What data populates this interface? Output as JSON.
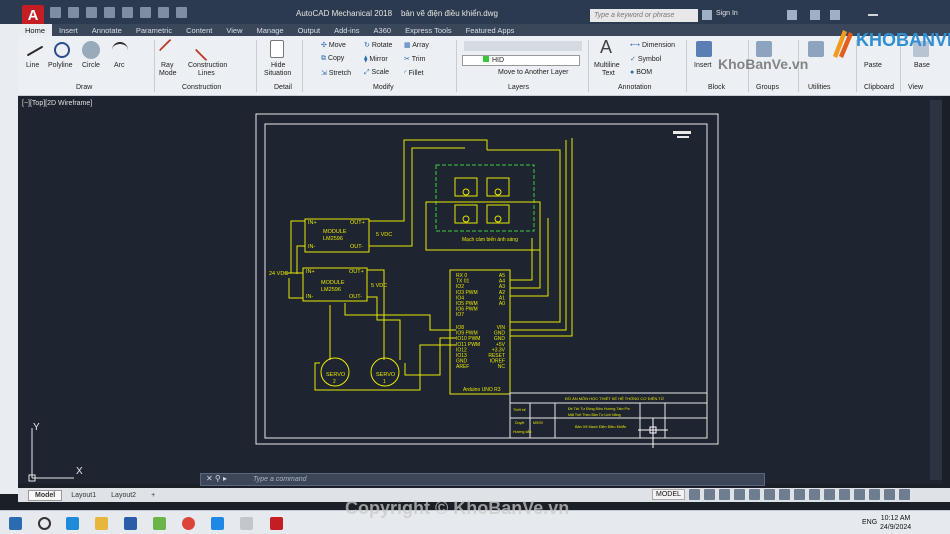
{
  "window": {
    "title": "AutoCAD Mechanical 2018",
    "file": "bản vẽ điện điều khiển.dwg",
    "search_placeholder": "Type a keyword or phrase",
    "sign_in": "Sign In"
  },
  "tabs": [
    "Home",
    "Insert",
    "Annotate",
    "Parametric",
    "Content",
    "View",
    "Manage",
    "Output",
    "Add-ins",
    "A360",
    "Express Tools",
    "Featured Apps"
  ],
  "ribbon": {
    "draw": {
      "title": "Draw",
      "line": "Line",
      "polyline": "Polyline",
      "circle": "Circle",
      "arc": "Arc"
    },
    "construction": {
      "title": "Construction",
      "ray": "Ray",
      "ray2": "Mode",
      "lines": "Construction",
      "lines2": "Lines"
    },
    "detail": {
      "title": "Detail",
      "hide": "Hide",
      "hide2": "Situation"
    },
    "modify": {
      "title": "Modify",
      "move": "Move",
      "rotate": "Rotate",
      "array": "Array",
      "copy": "Copy",
      "mirror": "Mirror",
      "trim": "Trim",
      "stretch": "Stretch",
      "scale": "Scale",
      "fillet": "Fillet"
    },
    "layers": {
      "title": "Layers",
      "layer_name": "HID",
      "move_to": "Move to Another Layer"
    },
    "annotation": {
      "title": "Annotation",
      "mtext": "Multiline",
      "mtext2": "Text",
      "dimension": "Dimension",
      "symbol": "Symbol",
      "bom": "BOM"
    },
    "block": {
      "title": "Block",
      "insert": "Insert"
    },
    "groups": {
      "title": "Groups"
    },
    "utilities": {
      "title": "Utilities"
    },
    "clipboard": {
      "title": "Clipboard",
      "paste": "Paste"
    },
    "view": {
      "title": "View",
      "base": "Base"
    }
  },
  "viewport_label": "[−][Top][2D Wireframe]",
  "drawing": {
    "module1": {
      "in_plus": "IN+",
      "in_minus": "IN-",
      "out_plus": "OUT+",
      "out_minus": "OUT-",
      "name": "MODULE",
      "part": "LM2596",
      "voltage": "5 VDC"
    },
    "module2": {
      "in_plus": "IN+",
      "in_minus": "IN-",
      "out_plus": "OUT+",
      "out_minus": "OUT-",
      "name": "MODULE",
      "part": "LM2596",
      "voltage": "5 VDC"
    },
    "supply": "24 VDC",
    "sensor_caption": "Mạch cảm biến ánh sáng",
    "arduino_left": [
      "RX 0",
      "TX 01",
      "IO2",
      "IO3 PWM",
      "IO4",
      "IO5 PWM",
      "IO6 PWM",
      "IO7",
      "IO8",
      "IO9 PWM",
      "IO10 PWM",
      "IO11 PWM",
      "IO12",
      "IO13",
      "GND",
      "AREF"
    ],
    "arduino_right": [
      "A5",
      "A4",
      "A3",
      "A2",
      "A1",
      "A0",
      "VIN",
      "GND",
      "GND",
      "+5V",
      "+3.3V",
      "RESET",
      "IOREF",
      "NC"
    ],
    "arduino_name": "Arduino UNO R3",
    "servo1": {
      "label": "SERVO",
      "num": "2"
    },
    "servo2": {
      "label": "SERVO",
      "num": "1"
    },
    "titleblock": {
      "school": "ĐỒ ÁN MÔN HỌC THIẾT KẾ HỆ THỐNG CƠ ĐIỆN TỬ",
      "project_l1": "Đề Tài: Tự Động Điều Hướng Tấm Pin",
      "project_l2": "Mặt Trời Theo Bản Tự Lịch Năng",
      "drawing_name": "Bản Vẽ Mạch Điện Điều Khiển",
      "designer": "Thiết kế",
      "checker": "Duyệt",
      "student_code": "MSSV",
      "instructor": "Hướng dẫn"
    }
  },
  "command_placeholder": "Type a command",
  "layout_tabs": [
    "Model",
    "Layout1",
    "Layout2"
  ],
  "status_model": "MODEL",
  "taskbar": {
    "lang": "ENG",
    "time": "10:12 AM",
    "date": "24/9/2024"
  },
  "watermark": "Copyright © KhoBanVe.vn",
  "logo": {
    "text": "KHOBANVE",
    "url": "KhoBanVe.vn"
  }
}
